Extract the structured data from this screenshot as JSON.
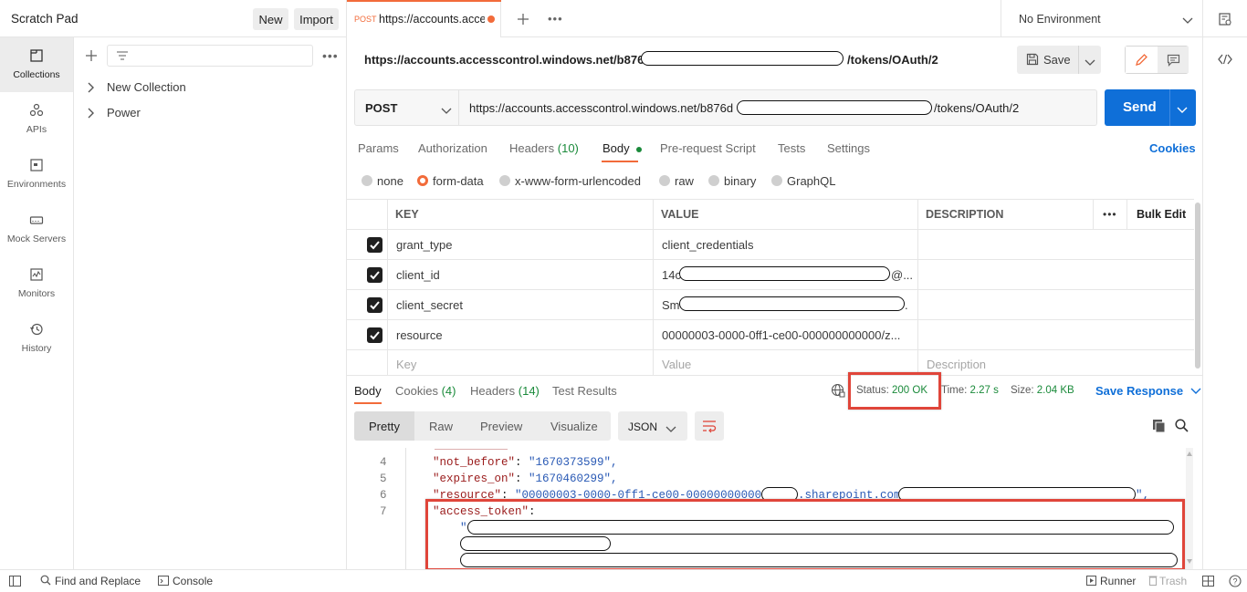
{
  "topbar": {
    "workspace_title": "Scratch Pad",
    "new_label": "New",
    "import_label": "Import",
    "tab_method": "POST",
    "tab_url": "https://accounts.acce",
    "environment": "No Environment"
  },
  "sidebar": {
    "items": [
      {
        "label": "Collections",
        "icon": "collections-icon"
      },
      {
        "label": "APIs",
        "icon": "apis-icon"
      },
      {
        "label": "Environments",
        "icon": "environments-icon"
      },
      {
        "label": "Mock Servers",
        "icon": "mock-servers-icon"
      },
      {
        "label": "Monitors",
        "icon": "monitors-icon"
      },
      {
        "label": "History",
        "icon": "history-icon"
      }
    ],
    "collections": [
      "New Collection",
      "Power"
    ]
  },
  "request": {
    "title_prefix": "https://accounts.accesscontrol.windows.net/b876d",
    "title_suffix": "/tokens/OAuth/2",
    "save_label": "Save",
    "method": "POST",
    "url_prefix": "https://accounts.accesscontrol.windows.net/b876d",
    "url_suffix": "/tokens/OAuth/2",
    "send_label": "Send",
    "tabs": [
      {
        "label": "Params"
      },
      {
        "label": "Authorization"
      },
      {
        "label": "Headers",
        "count": "(10)"
      },
      {
        "label": "Body"
      },
      {
        "label": "Pre-request Script"
      },
      {
        "label": "Tests"
      },
      {
        "label": "Settings"
      }
    ],
    "cookies_label": "Cookies",
    "body_types": [
      "none",
      "form-data",
      "x-www-form-urlencoded",
      "raw",
      "binary",
      "GraphQL"
    ],
    "table": {
      "headers": [
        "KEY",
        "VALUE",
        "DESCRIPTION"
      ],
      "bulk_edit": "Bulk Edit",
      "rows": [
        {
          "key": "grant_type",
          "value": "client_credentials"
        },
        {
          "key": "client_id",
          "value": "14c",
          "value_tail": "@..."
        },
        {
          "key": "client_secret",
          "value": "Sm",
          "value_tail": "."
        },
        {
          "key": "resource",
          "value": "00000003-0000-0ff1-ce00-000000000000/z..."
        }
      ],
      "placeholder_key": "Key",
      "placeholder_value": "Value",
      "placeholder_desc": "Description"
    }
  },
  "response": {
    "tabs": [
      {
        "label": "Body"
      },
      {
        "label": "Cookies",
        "count": "(4)"
      },
      {
        "label": "Headers",
        "count": "(14)"
      },
      {
        "label": "Test Results"
      }
    ],
    "status_label": "Status:",
    "status_value": "200 OK",
    "time_label": "Time:",
    "time_value": "2.27 s",
    "size_label": "Size:",
    "size_value": "2.04 KB",
    "save_response": "Save Response",
    "view_modes": [
      "Pretty",
      "Raw",
      "Preview",
      "Visualize"
    ],
    "format": "JSON",
    "lines": [
      {
        "num": "4",
        "key": "\"not_before\"",
        "value": "\"1670373599\","
      },
      {
        "num": "5",
        "key": "\"expires_on\"",
        "value": "\"1670460299\","
      },
      {
        "num": "6",
        "key": "\"resource\"",
        "value": "\"00000003-0000-0ff1-ce00-000000000000/",
        "value_mid": ".sharepoint.com@",
        "value_end": "\","
      },
      {
        "num": "7",
        "key": "\"access_token\"",
        "value": "\"e"
      }
    ]
  },
  "statusbar": {
    "find_replace": "Find and Replace",
    "console": "Console",
    "runner": "Runner",
    "trash": "Trash"
  },
  "colors": {
    "accent": "#f26b3a",
    "send_blue": "#0f6fd8",
    "link_blue": "#0f6fd8",
    "status_green": "#1a8a3a",
    "highlight_red": "#e0453a"
  }
}
